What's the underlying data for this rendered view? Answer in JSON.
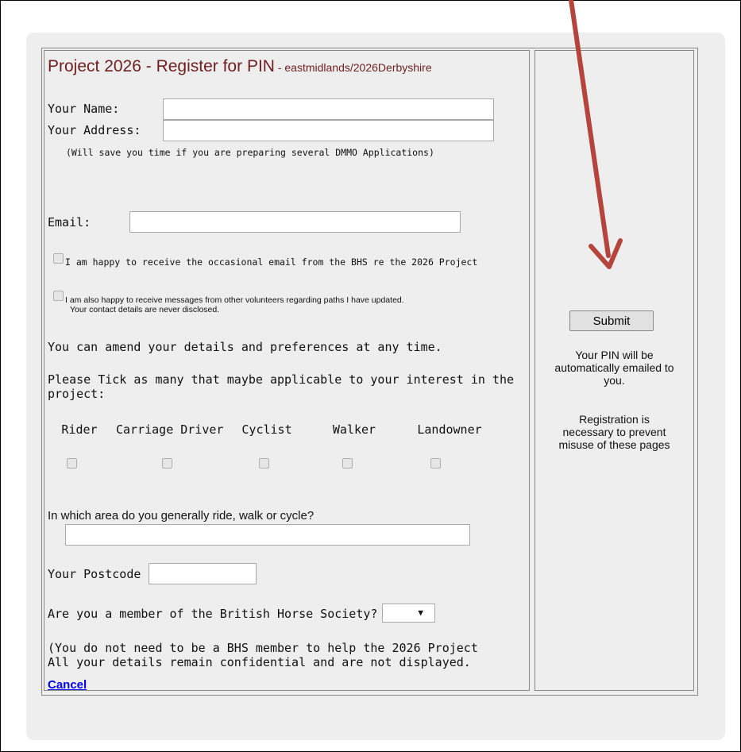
{
  "form": {
    "title_main": "Project 2026 - Register for PIN",
    "title_sub": " - eastmidlands/2026Derbyshire",
    "name_label": "Your Name:",
    "name_value": "",
    "address_label": "Your Address:",
    "address_value": "",
    "address_note": "(Will save you time if you are preparing several DMMO Applications)",
    "email_label": "Email:",
    "email_value": "",
    "optin_bhs": "I am happy to receive the occasional email from the BHS re the 2026 Project",
    "optin_volunteers_line1": "I am also happy to receive messages from other volunteers regarding paths I have updated.",
    "optin_volunteers_line2": "Your contact details are never disclosed.",
    "amend_text": "You can amend your details and preferences at any time.",
    "tick_text_line1": "Please Tick as many that maybe applicable to your interest in the",
    "tick_text_line2": "project:",
    "roles": [
      "Rider",
      "Carriage Driver",
      "Cyclist",
      "Walker",
      "Landowner"
    ],
    "area_question": "In  which area do you generally ride, walk or cycle?",
    "area_value": "",
    "postcode_label": "Your Postcode",
    "postcode_value": "",
    "member_question": "Are you a member of the British Horse Society?",
    "member_selected": "",
    "note_line1": "(You do not need to be a BHS member to help the 2026 Project",
    "note_line2": "All your details remain confidential and are not displayed.",
    "cancel_label": "Cancel"
  },
  "sidebar": {
    "submit_label": "Submit",
    "pin_text_line1": "Your PIN will be",
    "pin_text_line2": "automatically emailed to",
    "pin_text_line3": "you.",
    "reg_text_line1": "Registration is",
    "reg_text_line2": "necessary to prevent",
    "reg_text_line3": "misuse of these pages"
  },
  "annotation": {
    "arrow_color": "#b5443d",
    "icon": "arrow-down-icon"
  },
  "colors": {
    "title": "#6e1f1f",
    "panel": "#eeeeee",
    "link": "#0000ee"
  }
}
